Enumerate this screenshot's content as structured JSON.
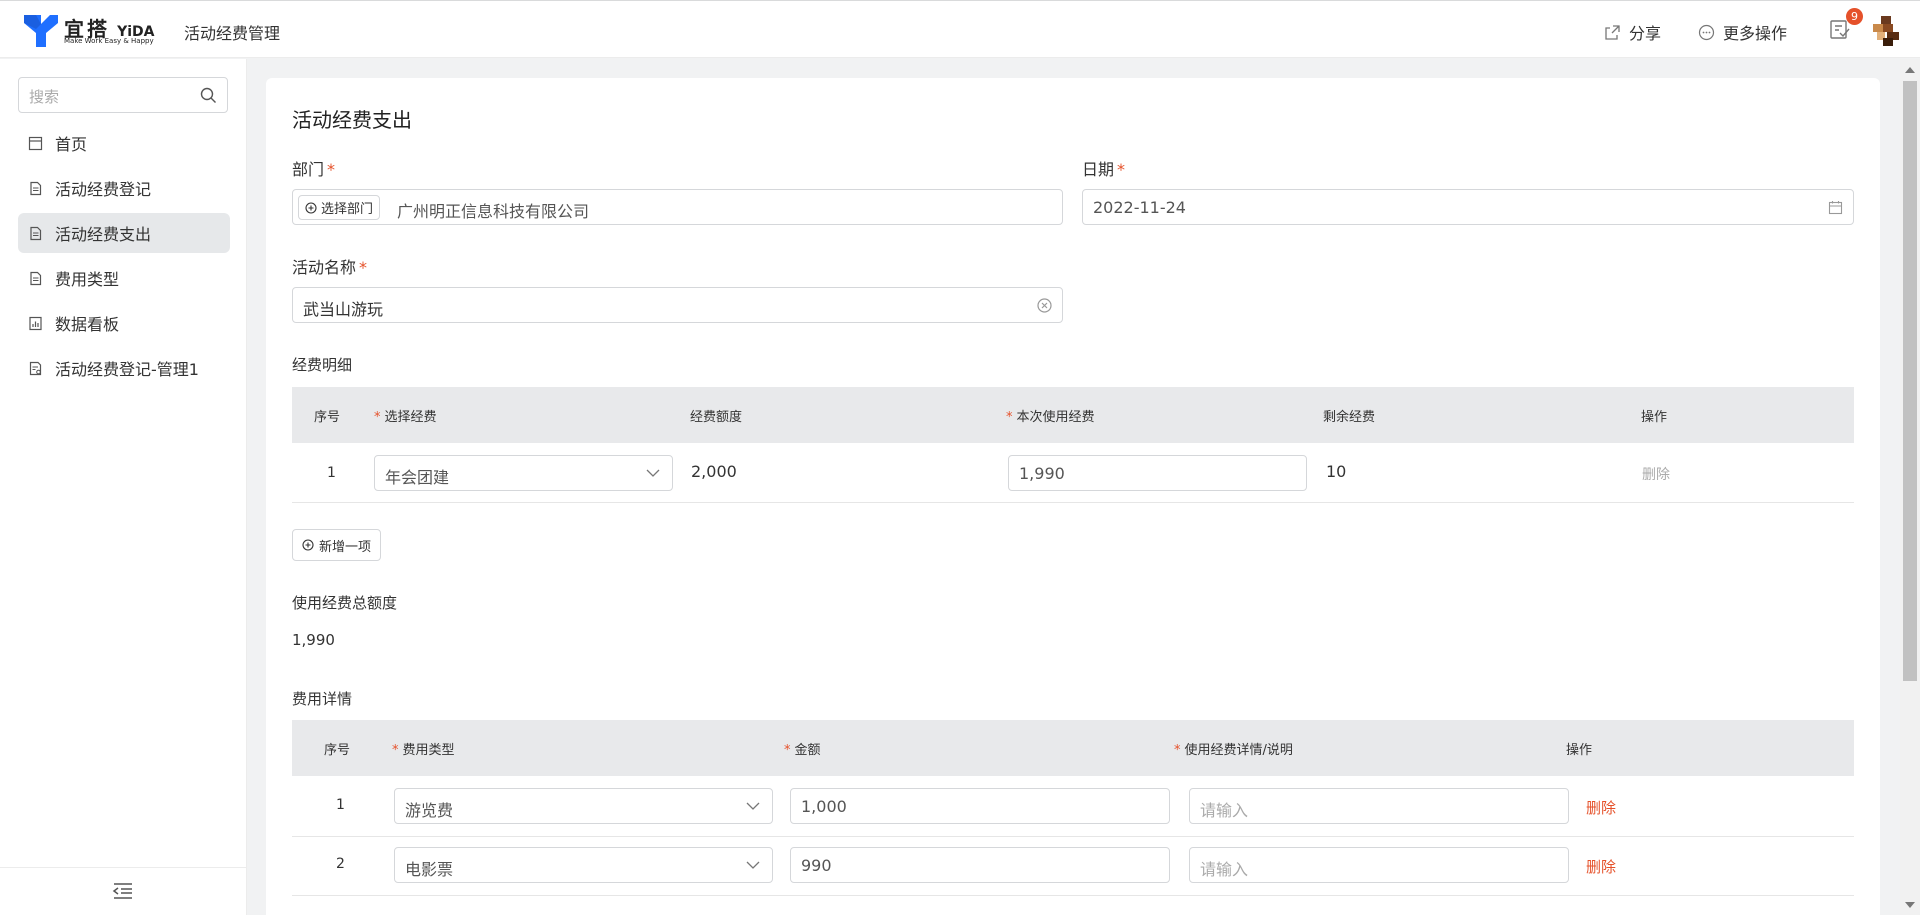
{
  "header": {
    "brand_cn": "宜搭",
    "brand_en": "YiDA",
    "brand_slogan": "Make Work Easy & Happy",
    "app_title": "活动经费管理",
    "share_label": "分享",
    "more_label": "更多操作",
    "todo_count": "9",
    "brand_color": "#1f6fff"
  },
  "sidebar": {
    "search_placeholder": "搜索",
    "items": [
      {
        "label": "首页",
        "icon": "home-icon"
      },
      {
        "label": "活动经费登记",
        "icon": "form-icon"
      },
      {
        "label": "活动经费支出",
        "icon": "form-icon",
        "active": true
      },
      {
        "label": "费用类型",
        "icon": "form-icon"
      },
      {
        "label": "数据看板",
        "icon": "report-icon"
      },
      {
        "label": "活动经费登记-管理1",
        "icon": "manage-icon"
      }
    ]
  },
  "form": {
    "title": "活动经费支出",
    "dept": {
      "label": "部门",
      "button": "选择部门",
      "value": "广州明正信息科技有限公司"
    },
    "date": {
      "label": "日期",
      "value": "2022-11-24"
    },
    "activity": {
      "label": "活动名称",
      "value": "武当山游玩"
    },
    "budget_detail": {
      "label": "经费明细",
      "headers": [
        "序号",
        "选择经费",
        "经费额度",
        "本次使用经费",
        "剩余经费",
        "操作"
      ],
      "rows": [
        {
          "index": "1",
          "budget": "年会团建",
          "limit": "2,000",
          "used": "1,990",
          "remaining": "10",
          "action": "删除"
        }
      ],
      "add_label": "新增一项"
    },
    "total": {
      "label": "使用经费总额度",
      "value": "1,990"
    },
    "cost_detail": {
      "label": "费用详情",
      "headers": [
        "序号",
        "费用类型",
        "金额",
        "使用经费详情/说明",
        "操作"
      ],
      "rows": [
        {
          "index": "1",
          "type": "游览费",
          "amount": "1,000",
          "note_placeholder": "请输入",
          "action": "删除"
        },
        {
          "index": "2",
          "type": "电影票",
          "amount": "990",
          "note_placeholder": "请输入",
          "action": "删除"
        }
      ]
    }
  }
}
